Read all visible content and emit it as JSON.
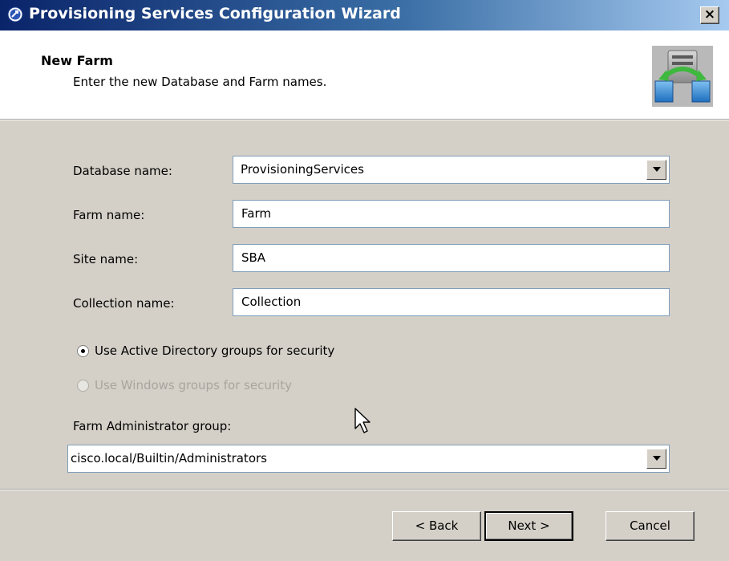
{
  "window": {
    "title": "Provisioning Services Configuration Wizard",
    "close_label": "×",
    "icons": {
      "app": "citrix-app-icon",
      "close": "close-icon",
      "logo": "server-sync-icon"
    }
  },
  "header": {
    "title": "New Farm",
    "subtitle": "Enter the new Database and Farm names."
  },
  "form": {
    "database_name": {
      "label": "Database name:",
      "value": "ProvisioningServices"
    },
    "farm_name": {
      "label": "Farm name:",
      "value": "Farm"
    },
    "site_name": {
      "label": "Site name:",
      "value": "SBA"
    },
    "collection_name": {
      "label": "Collection name:",
      "value": "Collection"
    },
    "security": {
      "options": [
        {
          "label": "Use Active Directory groups for security",
          "selected": true,
          "enabled": true
        },
        {
          "label": "Use Windows groups for security",
          "selected": false,
          "enabled": false
        }
      ]
    },
    "farm_admin_group": {
      "label": "Farm Administrator group:",
      "value": "cisco.local/Builtin/Administrators"
    }
  },
  "buttons": {
    "back": "< Back",
    "next": "Next >",
    "cancel": "Cancel"
  },
  "colors": {
    "titlebar_start": "#0a246a",
    "titlebar_end": "#a6caf0",
    "dialog_bg": "#d4d0c8"
  }
}
